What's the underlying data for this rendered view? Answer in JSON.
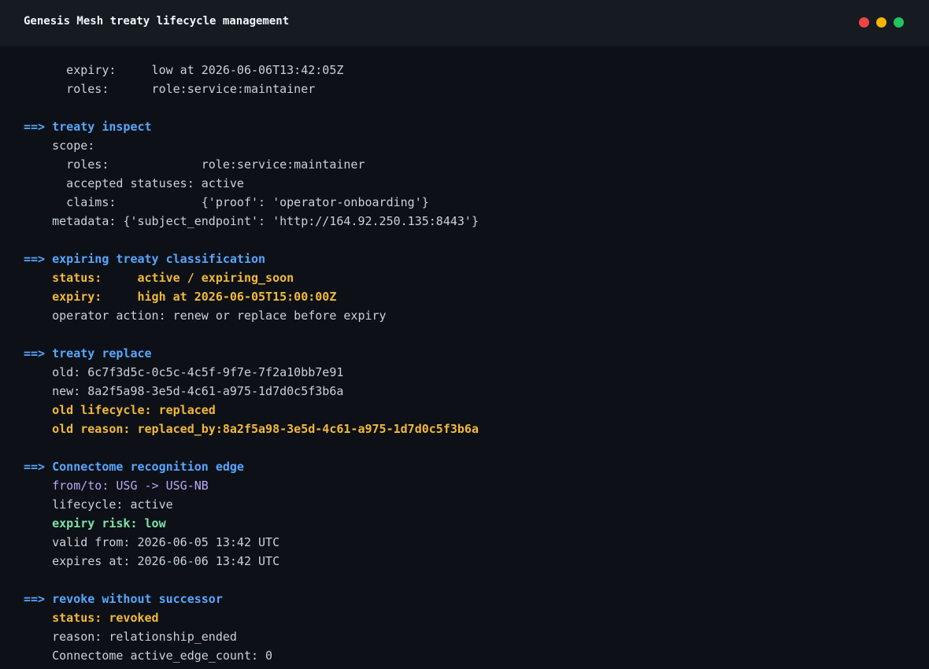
{
  "window": {
    "title": "Genesis Mesh treaty lifecycle management",
    "controls": [
      {
        "name": "close",
        "color": "#ef4444"
      },
      {
        "name": "minimize",
        "color": "#f5b400"
      },
      {
        "name": "maximize",
        "color": "#22c55e"
      }
    ]
  },
  "colors": {
    "background": "#0d1117",
    "titlebar": "#161b22",
    "header": "#58a6ff",
    "highlight": "#f2b83a",
    "good": "#7ee2a8",
    "text": "#c9d1d9"
  },
  "lines": [
    {
      "style": "plain",
      "text": "      expiry:     low at 2026-06-06T13:42:05Z"
    },
    {
      "style": "plain",
      "text": "      roles:      role:service:maintainer"
    },
    {
      "style": "blank",
      "text": ""
    },
    {
      "style": "header",
      "prefix": "==> ",
      "text": "treaty inspect"
    },
    {
      "style": "plain",
      "text": "    scope:"
    },
    {
      "style": "plain",
      "text": "      roles:             role:service:maintainer"
    },
    {
      "style": "plain",
      "text": "      accepted statuses: active"
    },
    {
      "style": "plain",
      "text": "      claims:            {'proof': 'operator-onboarding'}"
    },
    {
      "style": "plain",
      "text": "    metadata: {'subject_endpoint': 'http://164.92.250.135:8443'}"
    },
    {
      "style": "blank",
      "text": ""
    },
    {
      "style": "header",
      "prefix": "==> ",
      "text": "expiring treaty classification"
    },
    {
      "style": "hl",
      "text": "    status:     active / expiring_soon"
    },
    {
      "style": "hl",
      "text": "    expiry:     high at 2026-06-05T15:00:00Z"
    },
    {
      "style": "plain",
      "text": "    operator action: renew or replace before expiry"
    },
    {
      "style": "blank",
      "text": ""
    },
    {
      "style": "header",
      "prefix": "==> ",
      "text": "treaty replace"
    },
    {
      "style": "plain",
      "text": "    old: 6c7f3d5c-0c5c-4c5f-9f7e-7f2a10bb7e91"
    },
    {
      "style": "plain",
      "text": "    new: 8a2f5a98-3e5d-4c61-a975-1d7d0c5f3b6a"
    },
    {
      "style": "hl",
      "text": "    old lifecycle: replaced"
    },
    {
      "style": "hl",
      "text": "    old reason: replaced_by:8a2f5a98-3e5d-4c61-a975-1d7d0c5f3b6a"
    },
    {
      "style": "blank",
      "text": ""
    },
    {
      "style": "header",
      "prefix": "==> ",
      "text": "Connectome recognition edge"
    },
    {
      "style": "purple",
      "text": "    from/to: USG -> USG-NB"
    },
    {
      "style": "plain",
      "text": "    lifecycle: active"
    },
    {
      "style": "good",
      "text": "    expiry risk: low"
    },
    {
      "style": "plain",
      "text": "    valid from: 2026-06-05 13:42 UTC"
    },
    {
      "style": "plain",
      "text": "    expires at: 2026-06-06 13:42 UTC"
    },
    {
      "style": "blank",
      "text": ""
    },
    {
      "style": "header",
      "prefix": "==> ",
      "text": "revoke without successor"
    },
    {
      "style": "hl",
      "text": "    status: revoked"
    },
    {
      "style": "plain",
      "text": "    reason: relationship_ended"
    },
    {
      "style": "plain",
      "text": "    Connectome active_edge_count: 0"
    }
  ]
}
